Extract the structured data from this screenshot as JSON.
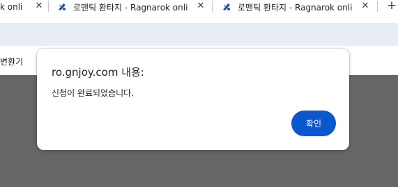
{
  "tabs": [
    {
      "title": "k onli",
      "close": "✕"
    },
    {
      "title": "로맨틱 환타지 - Ragnarok onli",
      "close": "✕"
    },
    {
      "title": "로맨틱 환타지 - Ragnarok onli",
      "close": "✕"
    }
  ],
  "new_tab_label": "+",
  "bookmarks_bar": {
    "item": "변환기"
  },
  "dialog": {
    "title": "ro.gnjoy.com 내용:",
    "message": "신청이 완료되었습니다.",
    "ok_label": "확인"
  },
  "colors": {
    "accent": "#0b57d0",
    "toolbar": "#e9eef6",
    "page_backdrop": "#666666"
  }
}
